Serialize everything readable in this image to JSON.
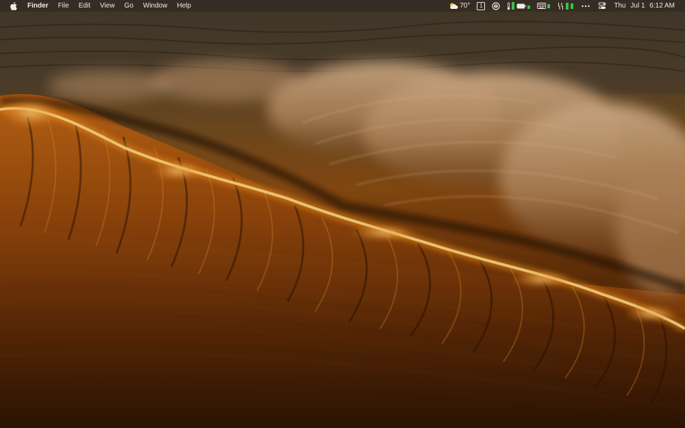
{
  "menubar": {
    "apple_icon": "apple-logo-icon",
    "app_name": "Finder",
    "menus": [
      "File",
      "Edit",
      "View",
      "Go",
      "Window",
      "Help"
    ],
    "status": {
      "weather_icon": "partly-cloudy-icon",
      "temperature": "70°",
      "calendar_day": "1",
      "clock_day": "Thu",
      "clock_date": "Jul 1",
      "clock_time": "6:12 AM"
    }
  },
  "desktop": {
    "wallpaper": "ocean-wave-sunset",
    "colors": {
      "menubar_bg": "#342c22",
      "wave_glow": "#ffb23a",
      "water_dark": "#3e1c04",
      "spray": "#c9a682"
    }
  }
}
